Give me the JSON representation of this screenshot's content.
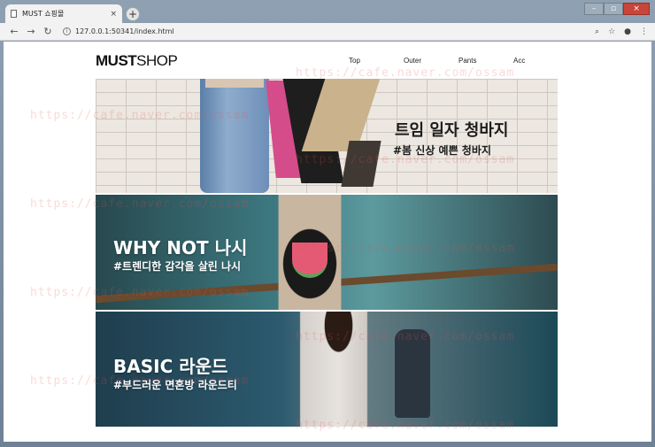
{
  "browser": {
    "tab_title": "MUST 쇼핑몰",
    "tab_close": "×",
    "new_tab": "+",
    "url": "127.0.0.1:50341/index.html",
    "window_controls": [
      "–",
      "▫",
      "×"
    ]
  },
  "site": {
    "logo_bold": "MUST",
    "logo_light": "SHOP",
    "menu": [
      "Top",
      "Outer",
      "Pants",
      "Acc"
    ]
  },
  "banners": [
    {
      "title": "트임 일자 청바지",
      "subtitle": "#봄 신상 예쁜 청바지"
    },
    {
      "title": "WHY NOT 나시",
      "subtitle": "#트렌디한 감각을 살린 나시"
    },
    {
      "title": "BASIC 라운드",
      "subtitle": "#부드러운 면혼방 라운드티"
    }
  ],
  "watermark": "https://cafe.naver.com/ossam",
  "colors": {
    "page_bg": "#ffffff",
    "chrome": "#f2f2f2",
    "banner_text": "#ffffff"
  }
}
